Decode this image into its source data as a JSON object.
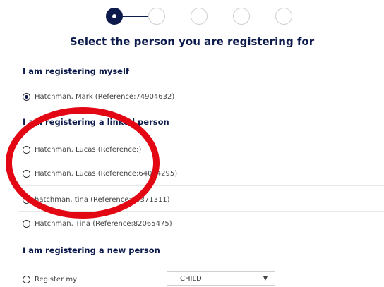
{
  "title": "Select the person you are registering for",
  "sections": {
    "myself": "I am registering myself",
    "linked": "I am registering a linked person",
    "new": "I am registering a new person"
  },
  "myself_option": "Hatchman, Mark (Reference:74904632)",
  "linked_options": [
    "Hatchman, Lucas (Reference:)",
    "Hatchman, Lucas (Reference:64034295)",
    "hatchman, tina (Reference:10371311)",
    "Hatchman, Tina (Reference:82065475)"
  ],
  "new_option": {
    "label": "Register my",
    "select_value": "CHILD"
  },
  "stepper": {
    "total_steps": 5,
    "current_step": 1
  },
  "colors": {
    "accent": "#0d1b4c",
    "annotation": "#e30613"
  },
  "icons": {
    "select_caret": "chevron-down-icon"
  }
}
